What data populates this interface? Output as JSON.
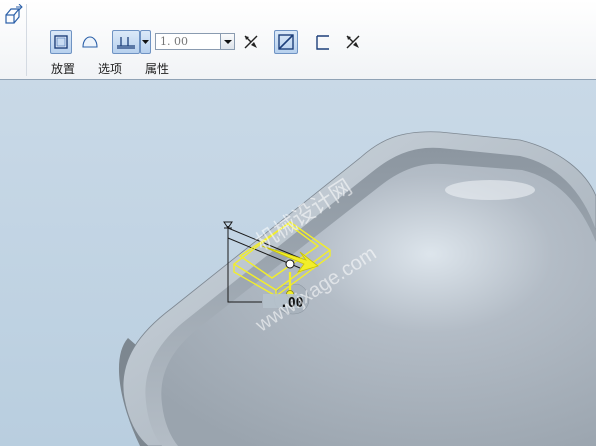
{
  "toolbar": {
    "depth_value": "1. 00",
    "tabs": [
      "放置",
      "选项",
      "属性"
    ]
  },
  "viewport": {
    "dimension_label": ".00",
    "watermark_line1": "机械设计网",
    "watermark_line2": "www.jxage.com"
  },
  "icons": {
    "feature": "extrude-feature-icon",
    "solid": "solid-icon",
    "surface": "surface-icon",
    "depth_option": "depth-blind-icon",
    "flip": "flip-direction-icon",
    "remove": "remove-material-icon",
    "thicken": "thicken-icon",
    "flip_thicken": "flip-thicken-icon"
  },
  "colors": {
    "accent": "#6f93c3",
    "viewport_bg": "#bcd0e0",
    "preview": "#f2ee2a"
  }
}
